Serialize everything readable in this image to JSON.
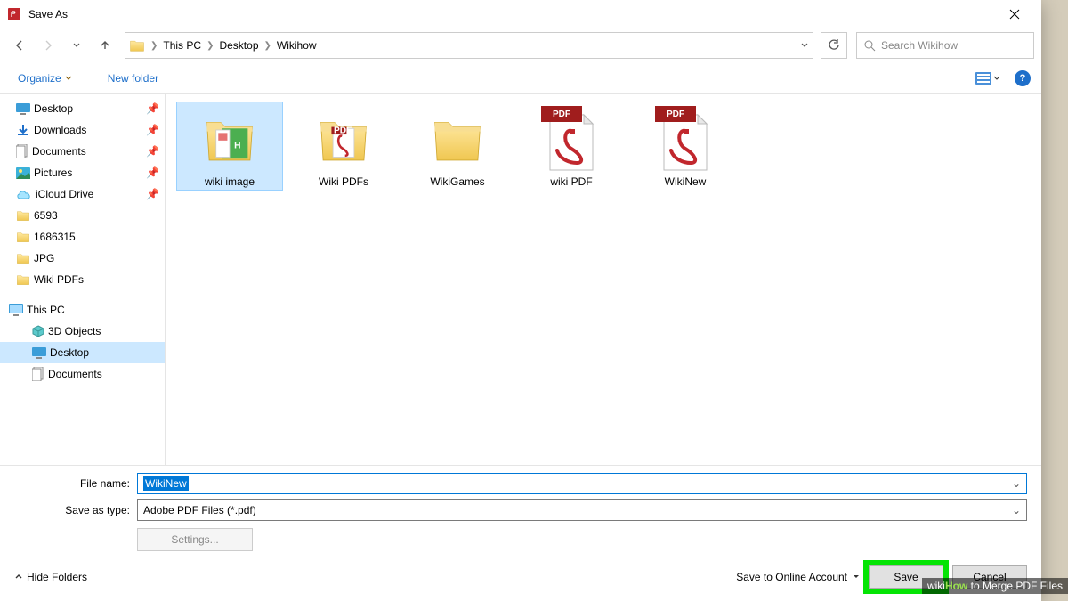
{
  "titlebar": {
    "title": "Save As"
  },
  "breadcrumbs": [
    "This PC",
    "Desktop",
    "Wikihow"
  ],
  "search_placeholder": "Search Wikihow",
  "toolbar": {
    "organize": "Organize",
    "newfolder": "New folder"
  },
  "sidebar": {
    "quick": [
      {
        "label": "Desktop",
        "icon": "desktop",
        "pin": true
      },
      {
        "label": "Downloads",
        "icon": "download",
        "pin": true
      },
      {
        "label": "Documents",
        "icon": "documents",
        "pin": true
      },
      {
        "label": "Pictures",
        "icon": "pictures",
        "pin": true
      },
      {
        "label": "iCloud Drive",
        "icon": "cloud",
        "pin": true
      },
      {
        "label": "6593",
        "icon": "folder",
        "pin": false
      },
      {
        "label": "1686315",
        "icon": "folder",
        "pin": false
      },
      {
        "label": "JPG",
        "icon": "folder",
        "pin": false
      },
      {
        "label": "Wiki PDFs",
        "icon": "folder",
        "pin": false
      }
    ],
    "thispc_label": "This PC",
    "thispc": [
      {
        "label": "3D Objects",
        "icon": "3d"
      },
      {
        "label": "Desktop",
        "icon": "desktop",
        "selected": true
      },
      {
        "label": "Documents",
        "icon": "documents"
      }
    ]
  },
  "files": [
    {
      "label": "wiki image",
      "type": "folder-preview-green",
      "selected": true
    },
    {
      "label": "Wiki PDFs",
      "type": "folder-preview-pdf"
    },
    {
      "label": "WikiGames",
      "type": "folder"
    },
    {
      "label": "wiki PDF",
      "type": "pdf"
    },
    {
      "label": "WikiNew",
      "type": "pdf"
    }
  ],
  "form": {
    "filename_label": "File name:",
    "filename_value": "WikiNew",
    "saveastype_label": "Save as type:",
    "saveastype_value": "Adobe PDF Files (*.pdf)",
    "settings": "Settings..."
  },
  "footer": {
    "hide": "Hide Folders",
    "online": "Save to Online Account",
    "save": "Save",
    "cancel": "Cancel"
  },
  "watermark": {
    "prefix": "wiki",
    "how": "How",
    "rest": " to Merge PDF Files"
  }
}
